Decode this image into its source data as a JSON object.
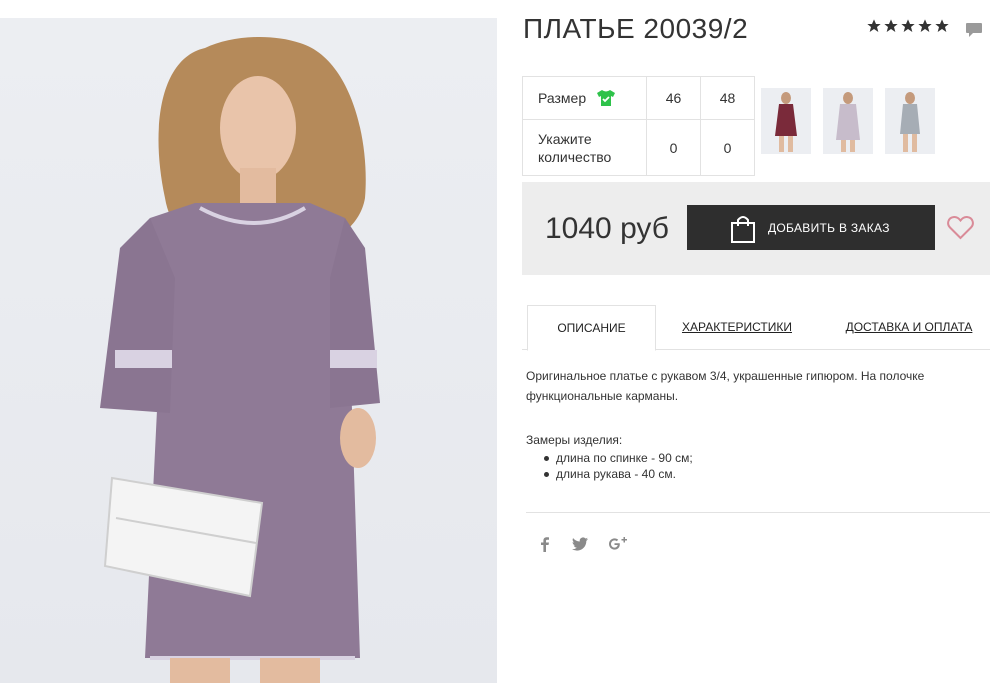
{
  "product": {
    "title": "ПЛАТЬЕ 20039/2",
    "rating_stars": 5,
    "price": "1040 руб",
    "add_to_order_label": "ДОБАВИТЬ В ЗАКАЗ"
  },
  "size_table": {
    "size_label": "Размер",
    "quantity_label": "Укажите количество",
    "sizes": [
      "46",
      "48"
    ],
    "quantities": [
      "0",
      "0"
    ]
  },
  "tabs": [
    {
      "label": "ОПИСАНИЕ",
      "active": true
    },
    {
      "label": "ХАРАКТЕРИСТИКИ",
      "active": false
    },
    {
      "label": "ДОСТАВКА И ОПЛАТА",
      "active": false
    }
  ],
  "description": {
    "text": "Оригинальное платье с рукавом 3/4, украшенные гипюром. На полочке функциональные карманы.",
    "measures_title": "Замеры изделия:",
    "measures": [
      "длина по спинке - 90 см;",
      "длина рукава - 40 см."
    ]
  },
  "colors": {
    "button_bg": "#2e2e2e",
    "price_box_bg": "#ededed",
    "heart": "#d98b98",
    "size_icon": "#2ec24a",
    "dress": "#8f7a96"
  },
  "icons": {
    "size_chart": "tshirt-check-icon",
    "cart": "shopping-bag-icon",
    "wishlist": "heart-icon",
    "reviews": "comment-icon",
    "social": [
      "facebook-icon",
      "twitter-icon",
      "google-plus-icon"
    ]
  }
}
